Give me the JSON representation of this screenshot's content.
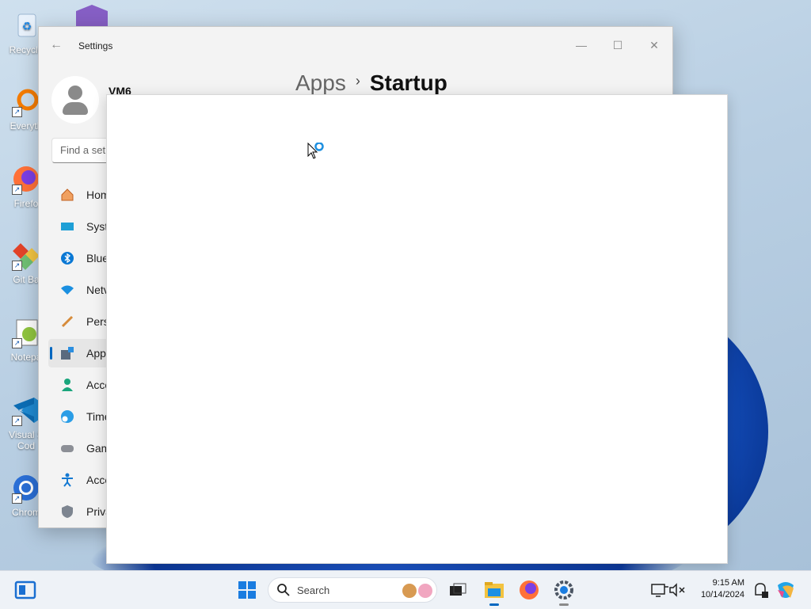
{
  "desktop": {
    "icons": [
      {
        "label": "Recycle",
        "icon": "recycle-bin-icon"
      },
      {
        "label": "Everyth",
        "icon": "everything-search-icon"
      },
      {
        "label": "Firefo",
        "icon": "firefox-icon"
      },
      {
        "label": "Git Ba",
        "icon": "git-bash-icon"
      },
      {
        "label": "Notepa",
        "icon": "notepad-plus-plus-icon"
      },
      {
        "label": "Visual S\nCod",
        "icon": "vscode-icon"
      },
      {
        "label": "Chrom",
        "icon": "chrome-icon"
      }
    ]
  },
  "settings": {
    "title": "Settings",
    "user": {
      "name": "VM6"
    },
    "search": {
      "placeholder": "Find a set"
    },
    "breadcrumb": {
      "parent": "Apps",
      "current": "Startup"
    },
    "nav": [
      {
        "label": "Hom",
        "icon": "home-icon"
      },
      {
        "label": "Syst",
        "icon": "system-icon"
      },
      {
        "label": "Blue",
        "icon": "bluetooth-icon"
      },
      {
        "label": "Netv",
        "icon": "network-icon"
      },
      {
        "label": "Pers",
        "icon": "personalization-icon"
      },
      {
        "label": "App",
        "icon": "apps-icon",
        "active": true
      },
      {
        "label": "Acco",
        "icon": "accounts-icon"
      },
      {
        "label": "Time",
        "icon": "time-language-icon"
      },
      {
        "label": "Gam",
        "icon": "gaming-icon"
      },
      {
        "label": "Acce",
        "icon": "accessibility-icon"
      },
      {
        "label": "Priva",
        "icon": "privacy-icon"
      }
    ]
  },
  "taskbar": {
    "search_label": "Search",
    "time": "9:15 AM",
    "date": "10/14/2024"
  },
  "colors": {
    "accent": "#0067c0",
    "taskbar": "#eef2f7"
  }
}
